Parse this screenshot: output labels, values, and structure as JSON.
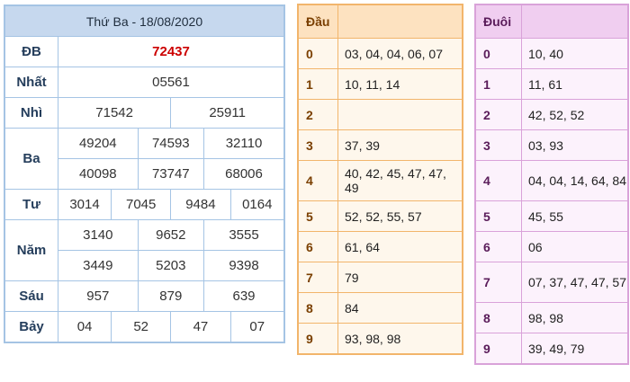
{
  "results": {
    "title": "Thứ Ba - 18/08/2020",
    "db_label": "ĐB",
    "db": "72437",
    "nhat_label": "Nhất",
    "nhat": "05561",
    "nhi_label": "Nhì",
    "nhi": [
      "71542",
      "25911"
    ],
    "ba_label": "Ba",
    "ba": [
      "49204",
      "74593",
      "32110",
      "40098",
      "73747",
      "68006"
    ],
    "tu_label": "Tư",
    "tu": [
      "3014",
      "7045",
      "9484",
      "0164"
    ],
    "nam_label": "Năm",
    "nam": [
      "3140",
      "9652",
      "3555",
      "3449",
      "5203",
      "9398"
    ],
    "sau_label": "Sáu",
    "sau": [
      "957",
      "879",
      "639"
    ],
    "bay_label": "Bảy",
    "bay": [
      "04",
      "52",
      "47",
      "07"
    ]
  },
  "dau": {
    "header": "Đầu",
    "rows": [
      {
        "key": "0",
        "vals": "03, 04, 04, 06, 07"
      },
      {
        "key": "1",
        "vals": "10, 11, 14"
      },
      {
        "key": "2",
        "vals": ""
      },
      {
        "key": "3",
        "vals": "37, 39"
      },
      {
        "key": "4",
        "vals": "40, 42, 45, 47, 47, 49"
      },
      {
        "key": "5",
        "vals": "52, 52, 55, 57"
      },
      {
        "key": "6",
        "vals": "61, 64"
      },
      {
        "key": "7",
        "vals": "79"
      },
      {
        "key": "8",
        "vals": "84"
      },
      {
        "key": "9",
        "vals": "93, 98, 98"
      }
    ]
  },
  "duoi": {
    "header": "Đuôi",
    "rows": [
      {
        "key": "0",
        "vals": "10, 40"
      },
      {
        "key": "1",
        "vals": "11, 61"
      },
      {
        "key": "2",
        "vals": "42, 52, 52"
      },
      {
        "key": "3",
        "vals": "03, 93"
      },
      {
        "key": "4",
        "vals": "04, 04, 14, 64, 84"
      },
      {
        "key": "5",
        "vals": "45, 55"
      },
      {
        "key": "6",
        "vals": "06"
      },
      {
        "key": "7",
        "vals": "07, 37, 47, 47, 57"
      },
      {
        "key": "8",
        "vals": "98, 98"
      },
      {
        "key": "9",
        "vals": "39, 49, 79"
      }
    ]
  }
}
